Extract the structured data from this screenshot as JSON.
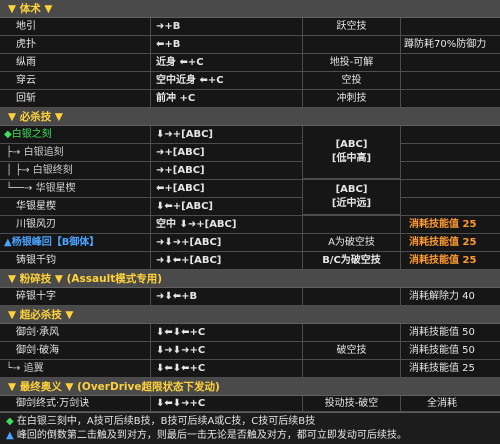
{
  "sections": {
    "tishu": "▼ 体术 ▼",
    "bisha": "▼ 必杀技 ▼",
    "fensui": "▼ 粉碎技 ▼ (Assault模式专用)",
    "chao": "▼ 超必杀技 ▼",
    "zuizhong": "▼ 最终奥义 ▼ (OverDrive超限状态下发动)"
  },
  "tishu_rows": [
    {
      "name": "地引",
      "cmd": "➜+B",
      "note": "跃空技",
      "extra": ""
    },
    {
      "name": "虎扑",
      "cmd": "⬅+B",
      "note": "",
      "extra": "蹲防耗70%防御力"
    },
    {
      "name": "纵雨",
      "cmd": "近身 ⬅+C",
      "note": "地投-可解",
      "extra": ""
    },
    {
      "name": "穿云",
      "cmd": "空中近身 ⬅+C",
      "note": "空投",
      "extra": ""
    },
    {
      "name": "回斩",
      "cmd": "前冲 +C",
      "note": "冲刺技",
      "extra": ""
    }
  ],
  "bisha_rows": [
    {
      "name": "◆白银之刻",
      "cmd": "⬇➜+[ABC]",
      "note": "",
      "extra": ""
    },
    {
      "name": "├→ 白银追刻",
      "cmd": "➜+[ABC]",
      "note": "",
      "extra": ""
    },
    {
      "name": "│ ├→ 白银终刻",
      "cmd": "➜+[ABC]",
      "note": "",
      "extra": ""
    },
    {
      "name": "└──→ 华银星楔",
      "cmd": "⬅+[ABC]",
      "note": "",
      "extra": ""
    },
    {
      "name": "华银星楔",
      "cmd": "⬇⬅+[ABC]",
      "note": "",
      "extra": ""
    },
    {
      "name": "川银风刃",
      "cmd": "空中 ⬇➜+[ABC]",
      "note": "",
      "extra": "消耗技能值 25"
    },
    {
      "name": "▲杨银峰回【B御体】",
      "cmd": "➜⬇➜+[ABC]",
      "note": "A为破空技",
      "extra": "消耗技能值 25"
    },
    {
      "name": "铸银千钧",
      "cmd": "➜⬇⬅+[ABC]",
      "note": "B/C为破空技",
      "extra": "消耗技能值 25"
    }
  ],
  "bisha_merge_labels": [
    "[ABC]\n[低中高]",
    "[ABC]\n[近中远]"
  ],
  "fensui_rows": [
    {
      "name": "碎银十字",
      "cmd": "➜⬇⬅+B",
      "note": "",
      "extra": "消耗解除力 40"
    }
  ],
  "chao_rows": [
    {
      "name": "御剑·承风",
      "cmd": "⬇⬅⬇⬅+C",
      "note": "",
      "extra": "消耗技能值 50"
    },
    {
      "name": "御剑·破海",
      "cmd": "⬇➜⬇➜+C",
      "note": "破空技",
      "extra": "消耗技能值 50"
    },
    {
      "name": "└→ 追翼",
      "cmd": "⬇⬅⬇⬅+C",
      "note": "",
      "extra": "消耗技能值 25"
    }
  ],
  "zuizhong_rows": [
    {
      "name": "御剑终式·万剑诀",
      "cmd": "⬇⬅⬇➜+C",
      "note": "投动技-破空",
      "extra": "全消耗"
    }
  ],
  "footer": {
    "line1_sym": "◆",
    "line1": "在白银三刻中，A技可后续B技，B技可后续A或C技，C技可后续B技",
    "line2_sym": "▲",
    "line2": "峰回的倒数第二击触及到对方，则最后一击无论是否触及对方，都可立即发动可后续技。"
  },
  "colors": {
    "section_bg": "#4a4a4a",
    "section_title": "#ffd23a",
    "cost_text": "#ff9a2e",
    "defense_tag": "#4aa3ff",
    "bullet_green": "#3ee05a"
  }
}
